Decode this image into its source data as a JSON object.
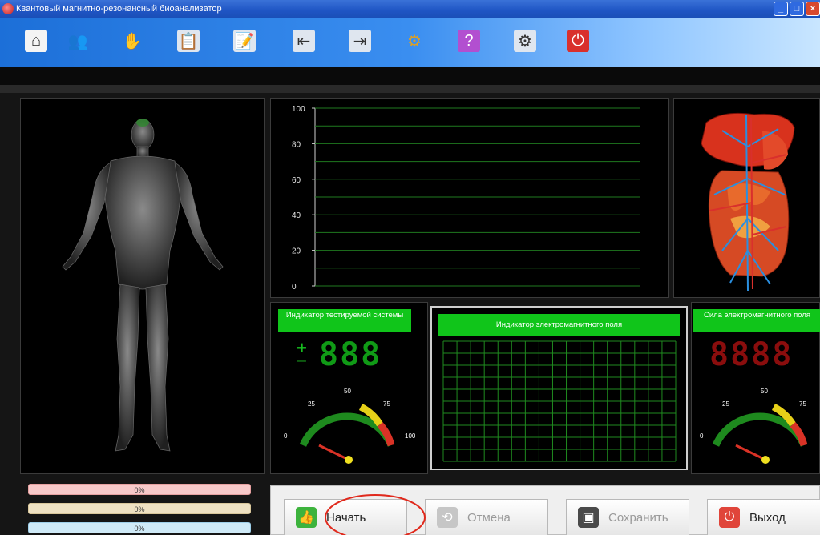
{
  "window": {
    "title": "Квантовый магнитно-резонансный биоанализатор"
  },
  "toolbar": {
    "items": [
      {
        "name": "home-icon",
        "glyph": "⌂",
        "bg": "#f4f4f4",
        "fg": "#222"
      },
      {
        "name": "users-icon",
        "glyph": "👥",
        "bg": "transparent",
        "fg": "#fff"
      },
      {
        "name": "hand-icon",
        "glyph": "✋",
        "bg": "transparent",
        "fg": "#f3d36b"
      },
      {
        "name": "clipboard-chart-icon",
        "glyph": "📋",
        "bg": "#dfe6ef",
        "fg": "#333"
      },
      {
        "name": "clipboard-edit-icon",
        "glyph": "📝",
        "bg": "#dfe6ef",
        "fg": "#333"
      },
      {
        "name": "export-report-icon",
        "glyph": "⇤",
        "bg": "#dfe6ef",
        "fg": "#333"
      },
      {
        "name": "import-report-icon",
        "glyph": "⇥",
        "bg": "#dfe6ef",
        "fg": "#333"
      },
      {
        "name": "gears-icon",
        "glyph": "⚙",
        "bg": "transparent",
        "fg": "#e0a020"
      },
      {
        "name": "help-icon",
        "glyph": "?",
        "bg": "#b24fd0",
        "fg": "#fff"
      },
      {
        "name": "user-settings-icon",
        "glyph": "⚙",
        "bg": "#dfe6ef",
        "fg": "#333"
      },
      {
        "name": "power-icon",
        "glyph": "⏻",
        "bg": "#d9302c",
        "fg": "#fff"
      }
    ]
  },
  "chart": {
    "y_ticks": [
      "100",
      "80",
      "60",
      "40",
      "20",
      "0"
    ],
    "grid_color": "#1f7a1f"
  },
  "system_indicator": {
    "label": "Индикатор тестируемой системы",
    "plus": "+",
    "minus": "−",
    "digits": "888",
    "gauge_ticks": [
      "0",
      "25",
      "50",
      "75",
      "100"
    ]
  },
  "em_indicator": {
    "label": "Индикатор электромагнитного поля"
  },
  "field_strength": {
    "label": "Сила электромагнитного поля",
    "digits": "8888",
    "gauge_ticks": [
      "0",
      "25",
      "50",
      "75"
    ]
  },
  "progress_bars": [
    {
      "value": "0%",
      "fraction": 0,
      "color": "#f7c9c9",
      "border": "#e6a0a0"
    },
    {
      "value": "0%",
      "fraction": 0,
      "color": "#efe2c3",
      "border": "#d9c79b"
    },
    {
      "value": "0%",
      "fraction": 0,
      "color": "#cfeaf7",
      "border": "#9fd0ea"
    }
  ],
  "buttons": {
    "start": "Начать",
    "cancel": "Отмена",
    "save": "Сохранить",
    "exit": "Выход"
  }
}
